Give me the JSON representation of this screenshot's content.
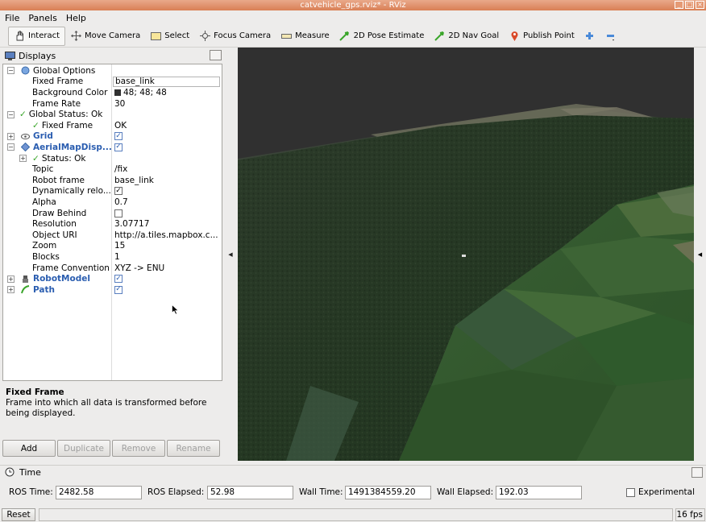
{
  "window": {
    "title": "catvehicle_gps.rviz* - RViz"
  },
  "menu": [
    "File",
    "Panels",
    "Help"
  ],
  "toolbar": {
    "interact": "Interact",
    "move_camera": "Move Camera",
    "select": "Select",
    "focus_camera": "Focus Camera",
    "measure": "Measure",
    "pose_estimate": "2D Pose Estimate",
    "nav_goal": "2D Nav Goal",
    "publish_point": "Publish Point",
    "colors": {
      "nav_green": "#3aa52a",
      "pin_red": "#d94a2a",
      "plus_blue": "#4a8ad8"
    }
  },
  "displays": {
    "title": "Displays",
    "rows": {
      "global_options": "Global Options",
      "fixed_frame_label": "Fixed Frame",
      "fixed_frame_value": "base_link",
      "background_color_label": "Background Color",
      "background_color_value": "48; 48; 48",
      "frame_rate_label": "Frame Rate",
      "frame_rate_value": "30",
      "global_status": "Global Status: Ok",
      "gs_fixed_frame_label": "Fixed Frame",
      "gs_fixed_frame_value": "OK",
      "grid": "Grid",
      "aerial": "AerialMapDisp...",
      "status_ok": "Status: Ok",
      "topic_label": "Topic",
      "topic_value": "/fix",
      "robot_frame_label": "Robot frame",
      "robot_frame_value": "base_link",
      "dyn_reload_label": "Dynamically relo...",
      "alpha_label": "Alpha",
      "alpha_value": "0.7",
      "draw_behind_label": "Draw Behind",
      "resolution_label": "Resolution",
      "resolution_value": "3.07717",
      "object_uri_label": "Object URI",
      "object_uri_value": "http://a.tiles.mapbox.c...",
      "zoom_label": "Zoom",
      "zoom_value": "15",
      "blocks_label": "Blocks",
      "blocks_value": "1",
      "frame_conv_label": "Frame Convention",
      "frame_conv_value": "XYZ -> ENU",
      "robot_model": "RobotModel",
      "path": "Path"
    },
    "checks": {
      "grid": true,
      "aerial": true,
      "dyn_reload": true,
      "draw_behind": false,
      "robot_model": true,
      "path": true
    }
  },
  "description": {
    "title": "Fixed Frame",
    "text": "Frame into which all data is transformed before being displayed."
  },
  "buttons": {
    "add": "Add",
    "duplicate": "Duplicate",
    "remove": "Remove",
    "rename": "Rename"
  },
  "time": {
    "title": "Time",
    "ros_time_label": "ROS Time:",
    "ros_time_value": "2482.58",
    "ros_elapsed_label": "ROS Elapsed:",
    "ros_elapsed_value": "52.98",
    "wall_time_label": "Wall Time:",
    "wall_time_value": "1491384559.20",
    "wall_elapsed_label": "Wall Elapsed:",
    "wall_elapsed_value": "192.03",
    "experimental_label": "Experimental",
    "experimental": false
  },
  "status": {
    "reset": "Reset",
    "fps": "16 fps"
  },
  "view": {
    "background": "#303030"
  }
}
